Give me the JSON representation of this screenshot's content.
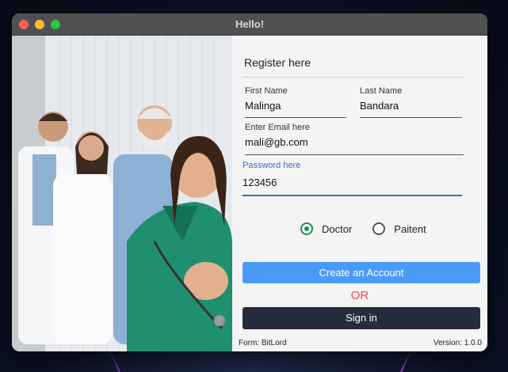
{
  "window": {
    "title": "Hello!"
  },
  "form": {
    "heading": "Register here",
    "first_name": {
      "label": "First Name",
      "value": "Malinga"
    },
    "last_name": {
      "label": "Last Name",
      "value": "Bandara"
    },
    "email": {
      "label": "Enter Email here",
      "value": "mali@gb.com"
    },
    "password": {
      "label": "Password here",
      "value": "123456"
    },
    "role_options": [
      {
        "label": "Doctor",
        "selected": true
      },
      {
        "label": "Paitent",
        "selected": false
      }
    ],
    "create_button": "Create an Account",
    "or_text": "OR",
    "signin_button": "Sign in"
  },
  "footer": {
    "left": "Form: BitLord",
    "right": "Version: 1.0.0"
  },
  "colors": {
    "accent_blue": "#4a9bf8",
    "signin_dark": "#242d3b",
    "or_red": "#f14b44",
    "radio_green": "#1e8c55",
    "focus_blue": "#3f67c4"
  }
}
